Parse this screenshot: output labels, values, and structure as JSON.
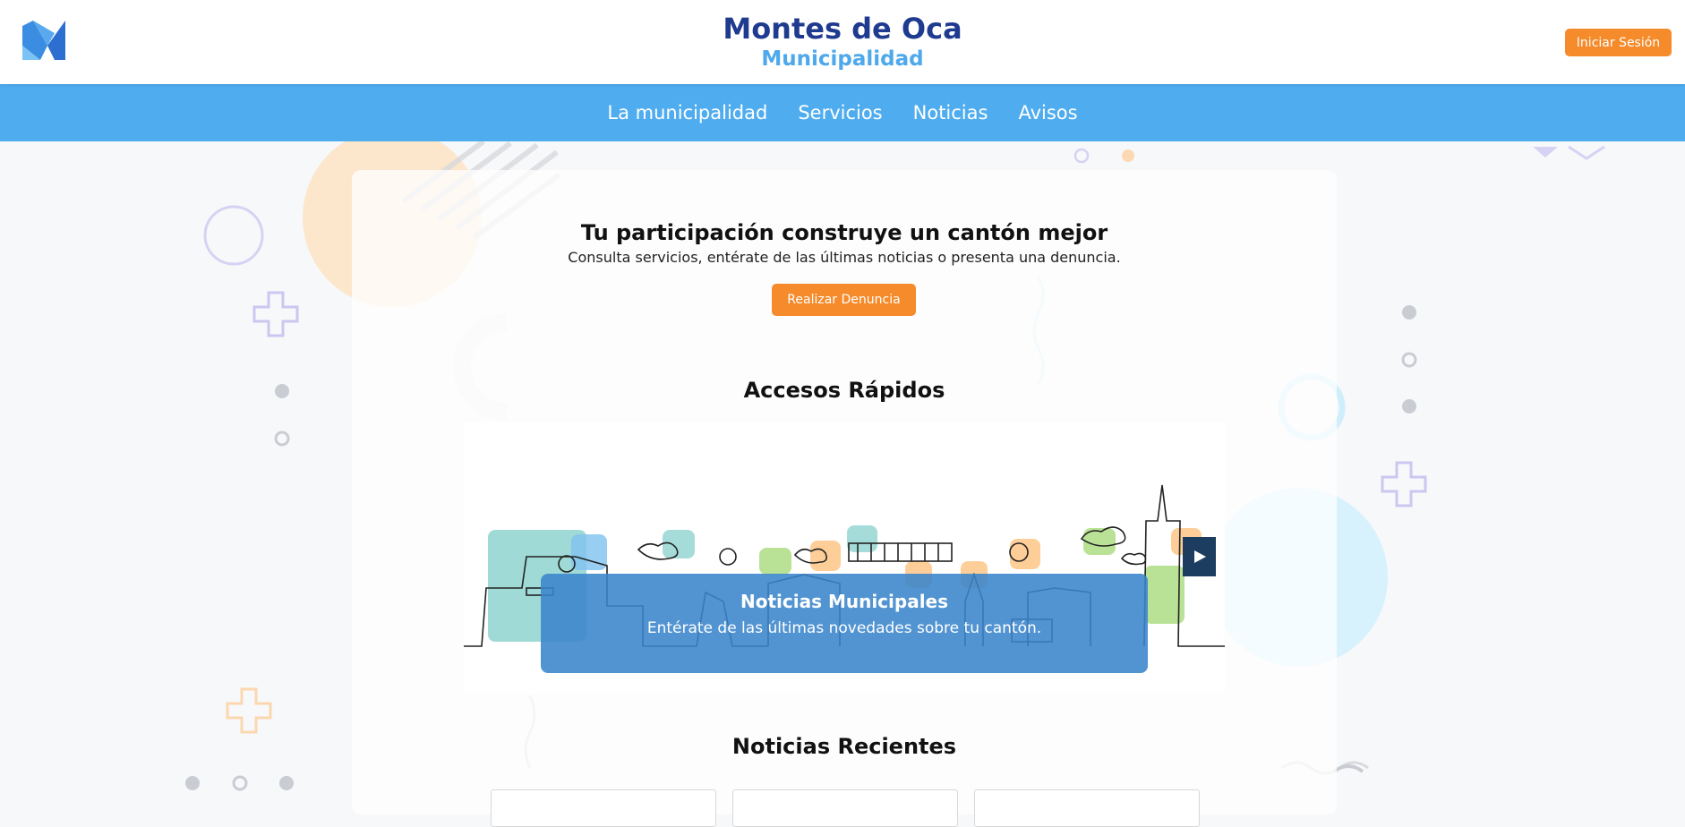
{
  "header": {
    "title": "Montes de Oca",
    "subtitle": "Municipalidad",
    "login_label": "Iniciar Sesión",
    "logo_icon": "municipality-m-logo"
  },
  "nav": {
    "items": [
      {
        "label": "La municipalidad"
      },
      {
        "label": "Servicios"
      },
      {
        "label": "Noticias"
      },
      {
        "label": "Avisos"
      }
    ]
  },
  "hero": {
    "title": "Tu participación construye un cantón mejor",
    "subtitle": "Consulta servicios, entérate de las últimas noticias o presenta una denuncia.",
    "button_label": "Realizar Denuncia"
  },
  "quick_access": {
    "title": "Accesos Rápidos",
    "slide": {
      "title": "Noticias Municipales",
      "text": "Entérate de las últimas novedades sobre tu cantón."
    },
    "play_icon": "play-icon"
  },
  "recent_news": {
    "title": "Noticias Recientes"
  },
  "colors": {
    "brand_dark": "#1f3b8f",
    "brand_light": "#4da8ec",
    "nav": "#4fadef",
    "accent": "#f58b2b",
    "caption": "#3a85cc"
  }
}
